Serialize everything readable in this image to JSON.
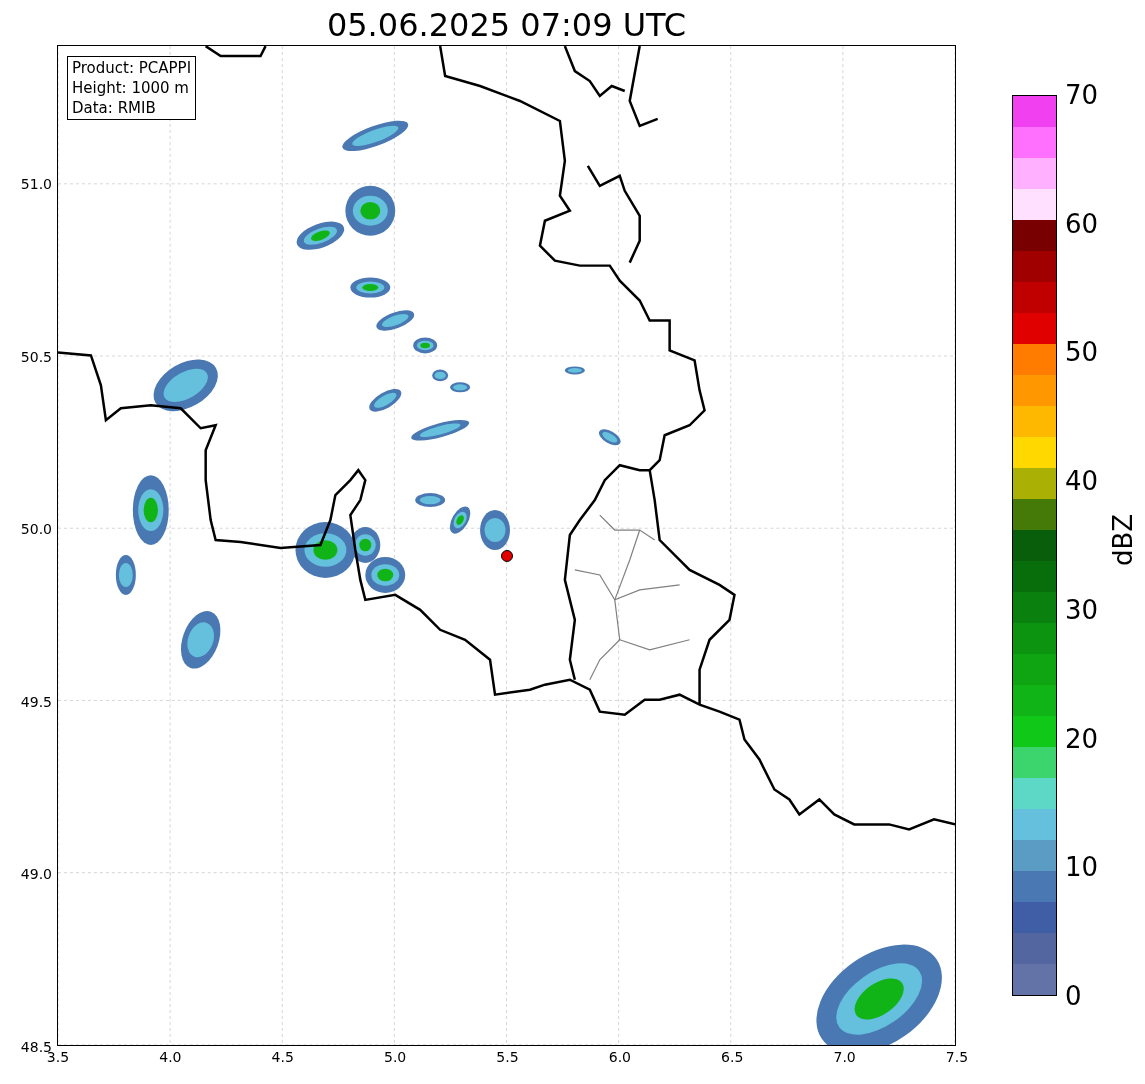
{
  "title": "05.06.2025 07:09 UTC",
  "info_box": [
    "Product: PCAPPI",
    "Height: 1000 m",
    "Data: RMIB"
  ],
  "map": {
    "y_ticks": [
      "51.0",
      "50.5",
      "50.0",
      "49.5",
      "49.0",
      "48.5"
    ],
    "x_ticks": [
      "3.5",
      "4.0",
      "4.5",
      "5.0",
      "5.5",
      "6.0",
      "6.5",
      "7.0",
      "7.5"
    ]
  },
  "colorbar": {
    "label": "dBZ",
    "ticks": [
      "70",
      "60",
      "50",
      "40",
      "30",
      "20",
      "10",
      "0"
    ],
    "bands": [
      {
        "color": "#f040f0"
      },
      {
        "color": "#ff70ff"
      },
      {
        "color": "#ffb0ff"
      },
      {
        "color": "#ffe0ff"
      },
      {
        "color": "#780000"
      },
      {
        "color": "#a00000"
      },
      {
        "color": "#c00000"
      },
      {
        "color": "#e00000"
      },
      {
        "color": "#ff7c00"
      },
      {
        "color": "#ff9800"
      },
      {
        "color": "#ffb800"
      },
      {
        "color": "#ffd800"
      },
      {
        "color": "#aab004"
      },
      {
        "color": "#467a08"
      },
      {
        "color": "#085e0a"
      },
      {
        "color": "#086e0c"
      },
      {
        "color": "#0a800e"
      },
      {
        "color": "#0c9410"
      },
      {
        "color": "#0ea412"
      },
      {
        "color": "#10b416"
      },
      {
        "color": "#10c818"
      },
      {
        "color": "#3cd46c"
      },
      {
        "color": "#5ed8c6"
      },
      {
        "color": "#64c0dc"
      },
      {
        "color": "#5a9cc4"
      },
      {
        "color": "#4a78b2"
      },
      {
        "color": "#405ea6"
      },
      {
        "color": "#5366a0"
      },
      {
        "color": "#6373a8"
      }
    ]
  }
}
